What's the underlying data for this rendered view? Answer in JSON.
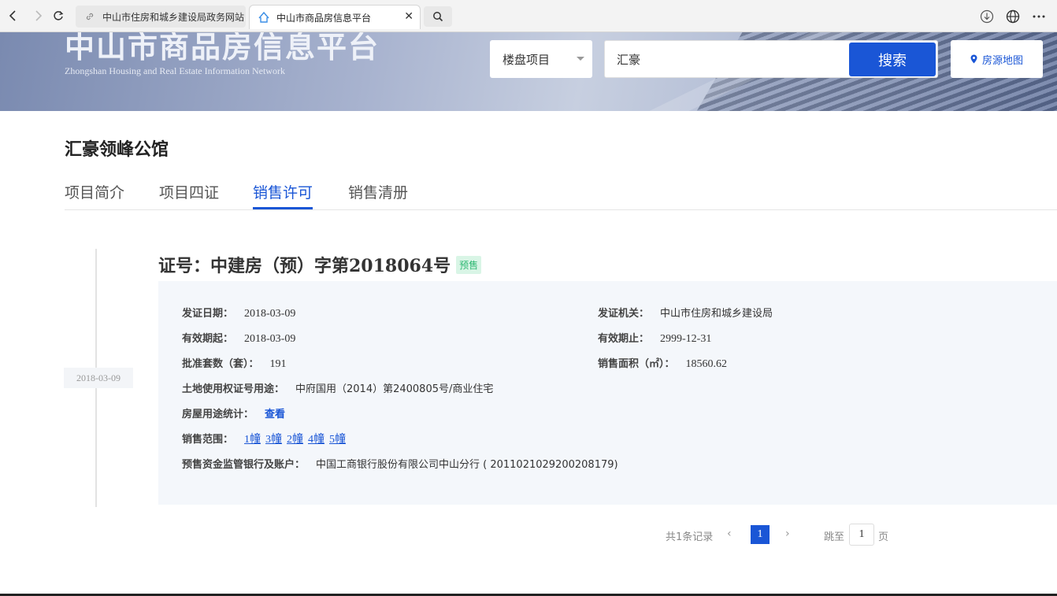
{
  "browser": {
    "tab1_title": "中山市住房和城乡建设局政务网站",
    "tab2_title": "中山市商品房信息平台",
    "tab_close": "✕"
  },
  "banner": {
    "site_title": "中山市商品房信息平台",
    "site_subtitle": "Zhongshan Housing and Real Estate Information Network",
    "select_value": "楼盘项目",
    "search_value": "汇豪",
    "search_button": "搜索",
    "map_button": "房源地图"
  },
  "project": {
    "name": "汇豪领峰公馆",
    "tabs": [
      "项目简介",
      "项目四证",
      "销售许可",
      "销售清册"
    ],
    "active_tab": "销售许可"
  },
  "permit": {
    "date_tag": "2018-03-09",
    "title": "证号：中建房（预）字第2018064号",
    "badge": "预售",
    "fields": {
      "issue_date_label": "发证日期：",
      "issue_date": "2018-03-09",
      "authority_label": "发证机关：",
      "authority": "中山市住房和城乡建设局",
      "valid_from_label": "有效期起：",
      "valid_from": "2018-03-09",
      "valid_to_label": "有效期止：",
      "valid_to": "2999-12-31",
      "units_label": "批准套数（套）：",
      "units": "191",
      "area_label": "销售面积（㎡）：",
      "area": "18560.62",
      "land_label": "土地使用权证号用途：",
      "land": "中府国用（2014）第2400805号/商业住宅",
      "usage_label": "房屋用途统计：",
      "usage_link": "查看",
      "scope_label": "销售范围：",
      "scope": [
        "1幢",
        "3幢",
        "2幢",
        "4幢",
        "5幢"
      ],
      "bank_label": "预售资金监管银行及账户：",
      "bank": "中国工商银行股份有限公司中山分行 ( 2011021029200208179)"
    }
  },
  "pagination": {
    "total": "共1条记录",
    "prev": "‹",
    "current": "1",
    "next": "›",
    "jump_label": "跳至",
    "jump_value": "1",
    "page_suffix": "页"
  },
  "colors": {
    "accent": "#1a56d6",
    "badge_bg": "#d9f5e6",
    "badge_fg": "#2eb872",
    "detail_bg": "#f4f7fb"
  }
}
